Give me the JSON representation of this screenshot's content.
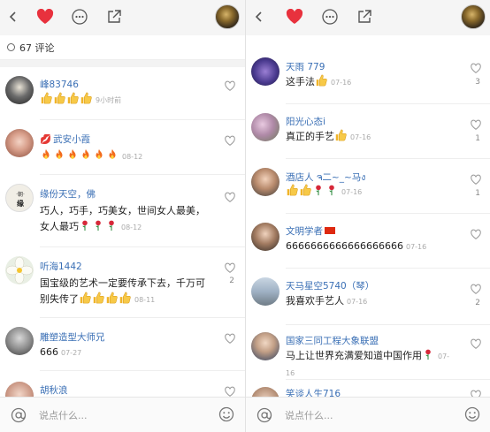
{
  "left": {
    "comment_count": "67 评论",
    "comments": [
      {
        "name": "峰83746",
        "text": "",
        "emoji": [
          "thumb",
          "thumb",
          "thumb",
          "thumb"
        ],
        "time": "9小时前",
        "likes": ""
      },
      {
        "name": "武安小霞",
        "text": "",
        "emoji": [
          "fire",
          "fire",
          "fire",
          "fire",
          "fire",
          "fire"
        ],
        "time": "08-12",
        "likes": ""
      },
      {
        "name": "缘份天空，佛",
        "text": "巧人，巧手，巧美女，世间女人最美，",
        "text2": "女人最巧",
        "emoji2": [
          "rose",
          "rose",
          "rose"
        ],
        "time": "08-12",
        "likes": ""
      },
      {
        "name": "听海1442",
        "text": "国宝级的艺术一定要传承下去，千万可",
        "text2": "别失传了",
        "emoji2": [
          "thumb",
          "thumb",
          "thumb",
          "thumb"
        ],
        "time": "08-11",
        "likes": "2"
      },
      {
        "name": "雕塑造型大师兄",
        "text": "666",
        "time": "07-27",
        "likes": ""
      },
      {
        "name": "胡秋浪",
        "text": "",
        "time": "",
        "likes": ""
      }
    ],
    "input_placeholder": "说点什么..."
  },
  "right": {
    "comments": [
      {
        "name": "天雨 779",
        "text": "这手法",
        "emoji": [
          "thumb"
        ],
        "time": "07-16",
        "likes": "3"
      },
      {
        "name": "阳光心态i",
        "text": "真正的手艺",
        "emoji": [
          "thumb"
        ],
        "time": "07-16",
        "likes": "1"
      },
      {
        "name": "酒店人 ຈ二~_~马ง",
        "text": "",
        "emoji": [
          "thumb",
          "thumb",
          "rose",
          "rose"
        ],
        "time": "07-16",
        "likes": "1"
      },
      {
        "name": "文明学者",
        "text": "6666666666666666666",
        "time": "07-16",
        "likes": ""
      },
      {
        "name": "天马星空5740（琴）",
        "text": "我喜欢手艺人",
        "time": "07-16",
        "likes": "2"
      },
      {
        "name": "国家三同工程大象联盟",
        "text": "马上让世界充满爱知道中国作用",
        "emoji": [
          "rose"
        ],
        "time": "07-16",
        "likes": ""
      },
      {
        "name": "笑谈人生716",
        "text": "",
        "time": "",
        "likes": ""
      }
    ],
    "input_placeholder": "说点什么..."
  },
  "colors": {
    "heart": "#e8313d",
    "name": "#3a6fb5",
    "topbar": "#f5f5f5"
  }
}
